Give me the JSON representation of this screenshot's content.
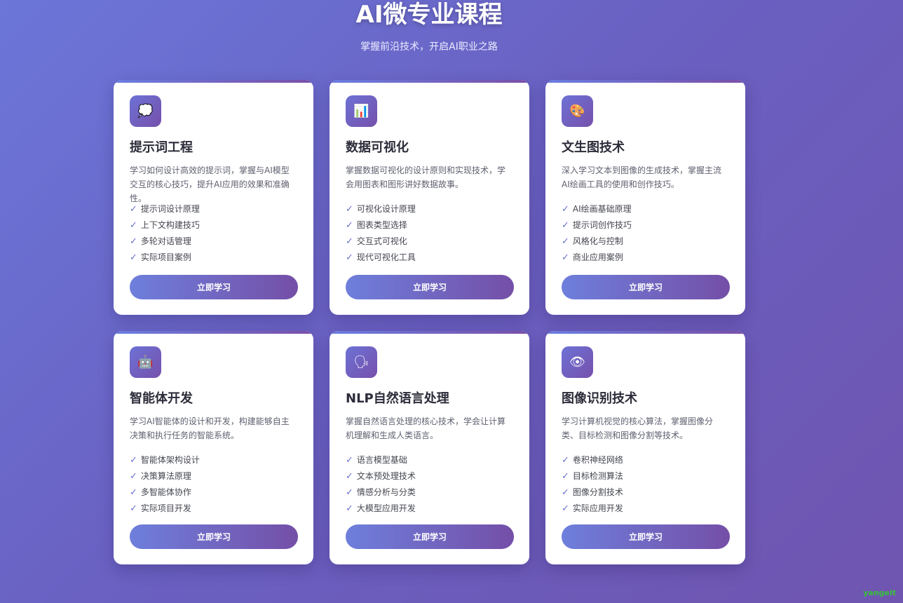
{
  "header": {
    "title": "AI微专业课程",
    "subtitle": "掌握前沿技术，开启AI职业之路"
  },
  "courses": [
    {
      "icon": "💭",
      "icon_name": "thought-bubble-icon",
      "title": "提示词工程",
      "desc": "学习如何设计高效的提示词，掌握与AI模型交互的核心技巧，提升AI应用的效果和准确性。",
      "features": [
        "提示词设计原理",
        "上下文构建技巧",
        "多轮对话管理",
        "实际项目案例"
      ],
      "button": "立即学习"
    },
    {
      "icon": "📊",
      "icon_name": "bar-chart-icon",
      "title": "数据可视化",
      "desc": "掌握数据可视化的设计原则和实现技术，学会用图表和图形讲好数据故事。",
      "features": [
        "可视化设计原理",
        "图表类型选择",
        "交互式可视化",
        "现代可视化工具"
      ],
      "button": "立即学习"
    },
    {
      "icon": "🎨",
      "icon_name": "palette-icon",
      "title": "文生图技术",
      "desc": "深入学习文本到图像的生成技术，掌握主流AI绘画工具的使用和创作技巧。",
      "features": [
        "AI绘画基础原理",
        "提示词创作技巧",
        "风格化与控制",
        "商业应用案例"
      ],
      "button": "立即学习"
    },
    {
      "icon": "🤖",
      "icon_name": "robot-icon",
      "title": "智能体开发",
      "desc": "学习AI智能体的设计和开发，构建能够自主决策和执行任务的智能系统。",
      "features": [
        "智能体架构设计",
        "决策算法原理",
        "多智能体协作",
        "实际项目开发"
      ],
      "button": "立即学习"
    },
    {
      "icon": "🗣",
      "icon_name": "speaking-head-icon",
      "title": "NLP自然语言处理",
      "desc": "掌握自然语言处理的核心技术，学会让计算机理解和生成人类语言。",
      "features": [
        "语言模型基础",
        "文本预处理技术",
        "情感分析与分类",
        "大模型应用开发"
      ],
      "button": "立即学习"
    },
    {
      "icon": "👁",
      "icon_name": "eye-icon",
      "title": "图像识别技术",
      "desc": "学习计算机视觉的核心算法，掌握图像分类、目标检测和图像分割等技术。",
      "features": [
        "卷积神经网络",
        "目标检测算法",
        "图像分割技术",
        "实际应用开发"
      ],
      "button": "立即学习"
    }
  ],
  "watermark": "yangeit",
  "colors": {
    "background_start": "#6b76d8",
    "background_end": "#6f55b0",
    "button_start": "#6e7fdc",
    "button_end": "#744fa7",
    "check": "#6a70cf"
  }
}
